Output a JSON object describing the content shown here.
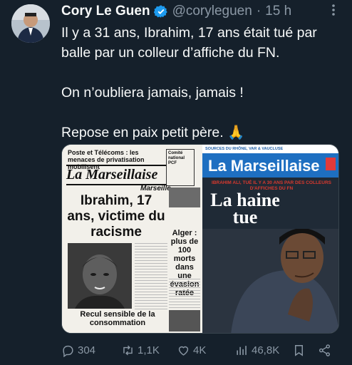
{
  "author": {
    "name": "Cory Le Guen",
    "handle": "@coryleguen",
    "separator": "·",
    "time": "15 h"
  },
  "tweet": {
    "line1": "Il y a 31 ans, Ibrahim, 17 ans était tué par",
    "line2": "balle par un colleur d’affiche du FN.",
    "line3": "On n’oubliera jamais, jamais !",
    "line4": "Repose en paix petit père. 🙏"
  },
  "media": {
    "left": {
      "top_headline": "Poste et Télécoms : les menaces de privatisation mobilisent",
      "box_text": "Comité national PCF",
      "masthead": "La Marseillaise",
      "city": "Marseille",
      "headline": "Ibrahim, 17 ans, victime du racisme",
      "side_headline": "Alger : plus de 100 morts dans une évasion ratée",
      "sub_headline": "Recul sensible de la consommation"
    },
    "right": {
      "topline": "SOURCES DU RHÔNE, VAR & VAUCLUSE",
      "masthead": "La Marseillaise",
      "pre_headline": "IBRAHIM ALI, TUÉ IL Y A 30 ANS PAR DES COLLEURS D'AFFICHES DU FN",
      "headline": "La haine tue"
    }
  },
  "actions": {
    "replies": "304",
    "reposts": "1,1K",
    "likes": "4K",
    "views": "46,8K"
  },
  "colors": {
    "background": "#15202b",
    "text": "#f7f9f9",
    "muted": "#8b98a5",
    "verified": "#1d9bf0",
    "masthead_blue": "#1e6fc1"
  }
}
